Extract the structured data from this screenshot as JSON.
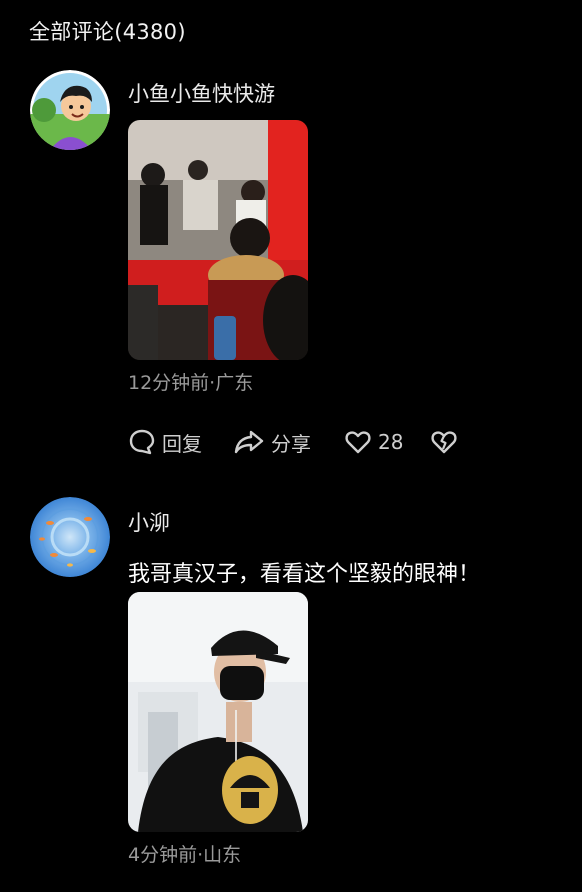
{
  "header": {
    "title": "全部评论(4380)"
  },
  "comments": [
    {
      "username": "小鱼小鱼快快游",
      "time_location": "12分钟前·广东",
      "actions": {
        "reply": "回复",
        "share": "分享",
        "likes": "28"
      },
      "avatar_icon": "cartoon-boy-avatar",
      "image_icon": "event-crowd-photo"
    },
    {
      "username": "小泖",
      "text": "我哥真汉子，看看这个坚毅的眼神！",
      "time_location": "4分钟前·山东",
      "avatar_icon": "blue-fish-pattern-avatar",
      "image_icon": "man-black-cap-mask-photo"
    }
  ],
  "colors": {
    "background": "#000000",
    "primary_text": "#ffffff",
    "secondary_text": "#9a9a9a",
    "icon": "#cfcfcf"
  }
}
